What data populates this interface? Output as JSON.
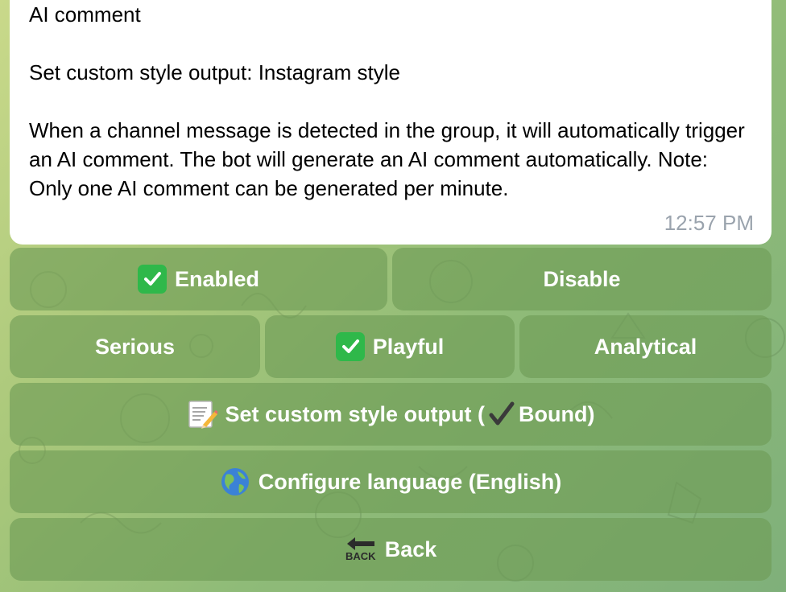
{
  "message": {
    "title": "AI comment",
    "style_line": "Set custom style output: Instagram style",
    "description": "When a channel message is detected in the group, it will automatically trigger an AI comment. The bot will generate an AI comment automatically. Note: Only one AI comment can be generated per minute.",
    "time": "12:57 PM"
  },
  "keyboard": {
    "enabled": {
      "label": "Enabled",
      "icon": "check-mark-button-icon"
    },
    "disable": {
      "label": "Disable"
    },
    "serious": {
      "label": "Serious"
    },
    "playful": {
      "label": "Playful",
      "icon": "check-mark-button-icon"
    },
    "analytical": {
      "label": "Analytical"
    },
    "custom_style": {
      "label_before": "Set custom style output (",
      "label_after": "Bound)",
      "icon": "memo-icon",
      "inline_icon": "heavy-check-icon"
    },
    "language": {
      "label": "Configure language (English)",
      "icon": "globe-icon"
    },
    "back": {
      "label": "Back",
      "icon": "back-arrow-icon",
      "icon_text": "BACK"
    }
  },
  "colors": {
    "button_bg": "#6e9b55",
    "check_green": "#2fb84a",
    "timestamp": "#9aa3ad"
  }
}
